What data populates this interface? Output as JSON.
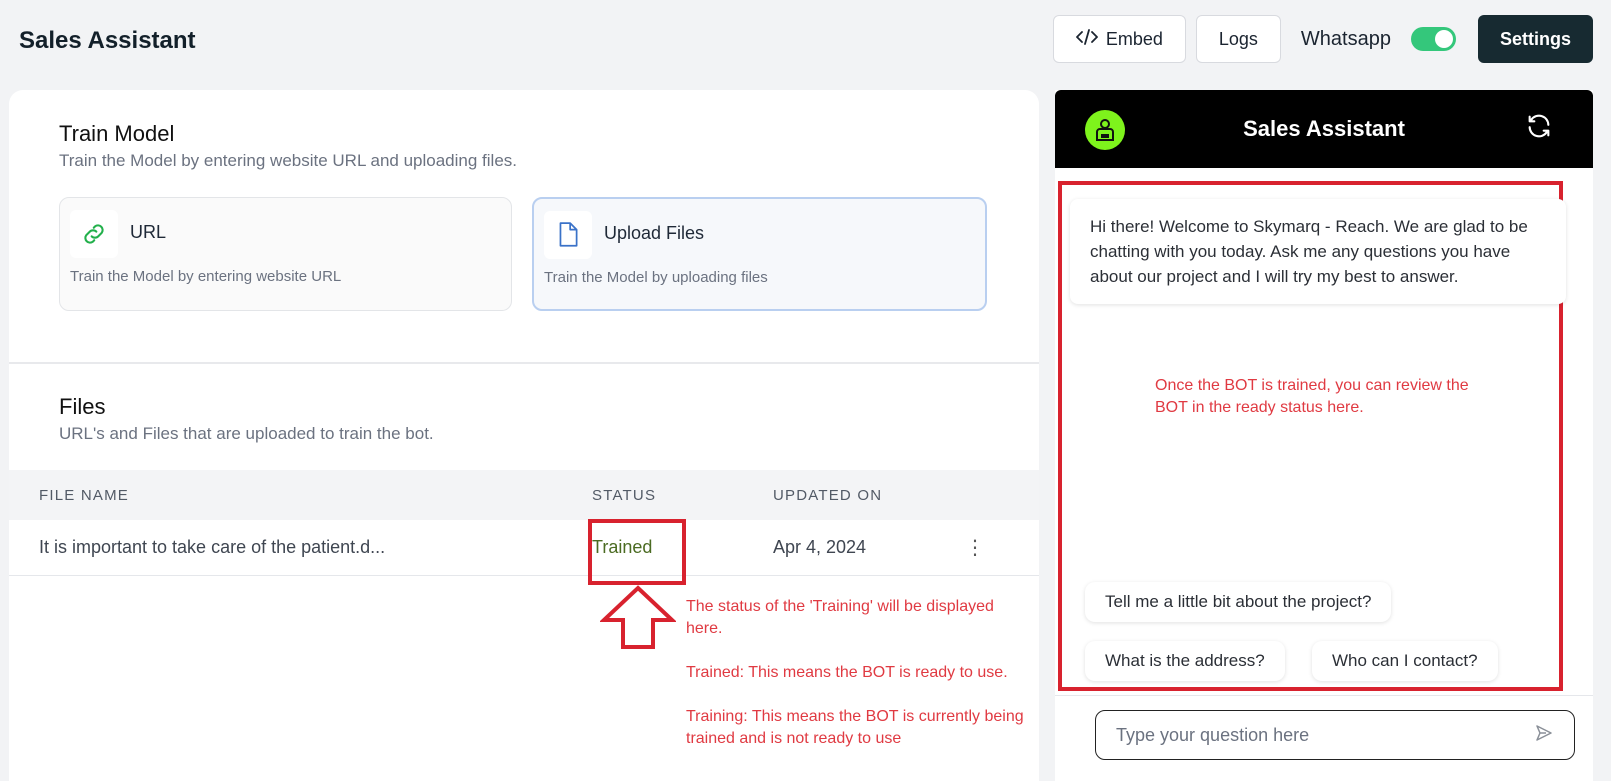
{
  "header": {
    "title": "Sales Assistant",
    "embed_label": "Embed",
    "logs_label": "Logs",
    "whatsapp_label": "Whatsapp",
    "whatsapp_enabled": true,
    "settings_label": "Settings"
  },
  "train": {
    "title": "Train Model",
    "subtitle": "Train the Model by entering website URL and uploading files.",
    "cards": [
      {
        "title": "URL",
        "desc": "Train the Model by entering website URL",
        "icon": "link-icon"
      },
      {
        "title": "Upload Files",
        "desc": "Train the Model by uploading files",
        "icon": "file-icon"
      }
    ]
  },
  "files": {
    "title": "Files",
    "subtitle": "URL's and Files that are uploaded to train the bot.",
    "columns": [
      "FILE NAME",
      "STATUS",
      "UPDATED ON"
    ],
    "rows": [
      {
        "name": "It is important to take care of the patient.d...",
        "status": "Trained",
        "updated": "Apr 4, 2024"
      }
    ]
  },
  "annotations": {
    "status_note": [
      "The status of the 'Training' will be displayed here.",
      "Trained: This means the BOT is ready to use.",
      "Training: This means the BOT is currently being trained and is not ready to use"
    ],
    "chat_note": "Once the BOT is trained, you can review the BOT in the ready status here."
  },
  "chat": {
    "title": "Sales Assistant",
    "welcome": "Hi there! Welcome to Skymarq - Reach. We are glad to be chatting with you today. Ask me any questions you have about our project and I will try my best to answer.",
    "suggestions": [
      "Tell me a little bit about the project?",
      "What is the address?",
      "Who can I contact?"
    ],
    "input_placeholder": "Type your question here"
  },
  "colors": {
    "accent_dark": "#172a31",
    "toggle_on": "#34c77b",
    "annotation_red": "#d8222e",
    "bot_avatar": "#7ef31c",
    "trained_status": "#4b6b22"
  }
}
